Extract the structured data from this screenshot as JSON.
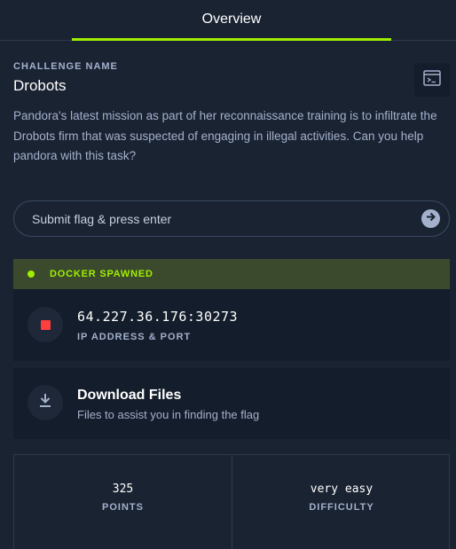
{
  "tabs": {
    "active_label": "Overview"
  },
  "challenge": {
    "name_label": "CHALLENGE NAME",
    "name": "Drobots",
    "description": "Pandora's latest mission as part of her reconnaissance training is to infiltrate the Drobots firm that was suspected of engaging in illegal activities. Can you help pandora with this task?"
  },
  "flag_input": {
    "placeholder": "Submit flag & press enter",
    "value": ""
  },
  "docker": {
    "status": "DOCKER SPAWNED",
    "ip_port": "64.227.36.176:30273",
    "ip_label": "IP ADDRESS & PORT"
  },
  "download": {
    "title": "Download Files",
    "subtitle": "Files to assist you in finding the flag"
  },
  "stats": {
    "points_value": "325",
    "points_label": "POINTS",
    "difficulty_value": "very easy",
    "difficulty_label": "DIFFICULTY"
  },
  "colors": {
    "accent": "#9fef00",
    "background": "#1a2332",
    "card": "#141d2b",
    "muted_text": "#a4b1cd",
    "stop": "#ff3e3e"
  },
  "icons": {
    "terminal": "terminal-icon",
    "submit": "arrow-right-circle-icon",
    "status": "status-dot-icon",
    "stop": "stop-icon",
    "download": "download-icon"
  }
}
